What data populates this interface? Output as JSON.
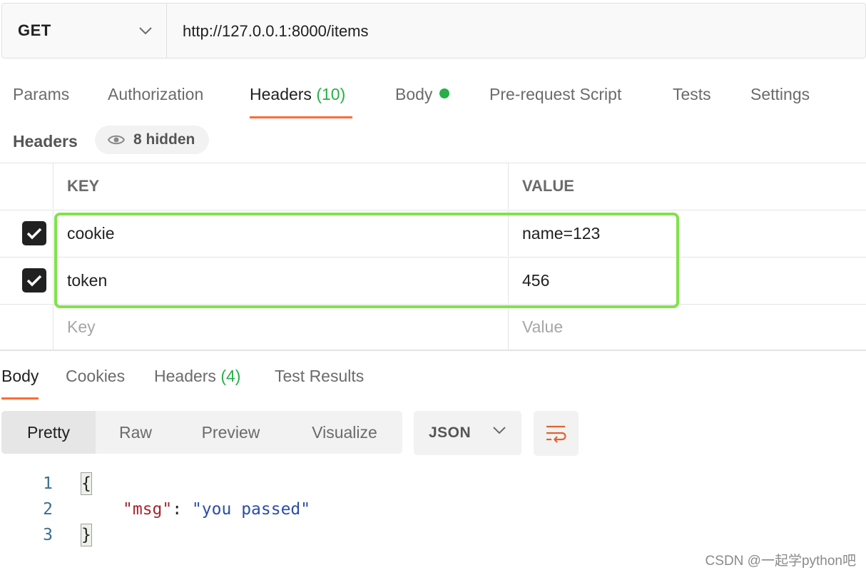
{
  "request": {
    "method": "GET",
    "url": "http://127.0.0.1:8000/items",
    "tabs": [
      {
        "label": "Params"
      },
      {
        "label": "Authorization"
      },
      {
        "label": "Headers",
        "count": "(10)"
      },
      {
        "label": "Body"
      },
      {
        "label": "Pre-request Script"
      },
      {
        "label": "Tests"
      },
      {
        "label": "Settings"
      }
    ],
    "active_tab": "Headers"
  },
  "headers_section": {
    "title": "Headers",
    "hidden_label": "8 hidden",
    "columns": {
      "key": "KEY",
      "value": "VALUE"
    },
    "rows": [
      {
        "key": "cookie",
        "value": "name=123",
        "checked": true
      },
      {
        "key": "token",
        "value": "456",
        "checked": true
      }
    ],
    "placeholder": {
      "key": "Key",
      "value": "Value"
    }
  },
  "response": {
    "tabs": [
      {
        "label": "Body"
      },
      {
        "label": "Cookies"
      },
      {
        "label": "Headers",
        "count": "(4)"
      },
      {
        "label": "Test Results"
      }
    ],
    "active_tab": "Body",
    "view_modes": [
      "Pretty",
      "Raw",
      "Preview",
      "Visualize"
    ],
    "active_view": "Pretty",
    "format": "JSON",
    "code": {
      "line_numbers": [
        "1",
        "2",
        "3"
      ],
      "open_brace": "{",
      "key": "\"msg\"",
      "colon": ": ",
      "value": "\"you passed\"",
      "close_brace": "}"
    }
  },
  "watermark": "CSDN @一起学python吧",
  "colors": {
    "accent": "#ff6c37",
    "success": "#26b047",
    "highlight": "#7ee34a"
  }
}
